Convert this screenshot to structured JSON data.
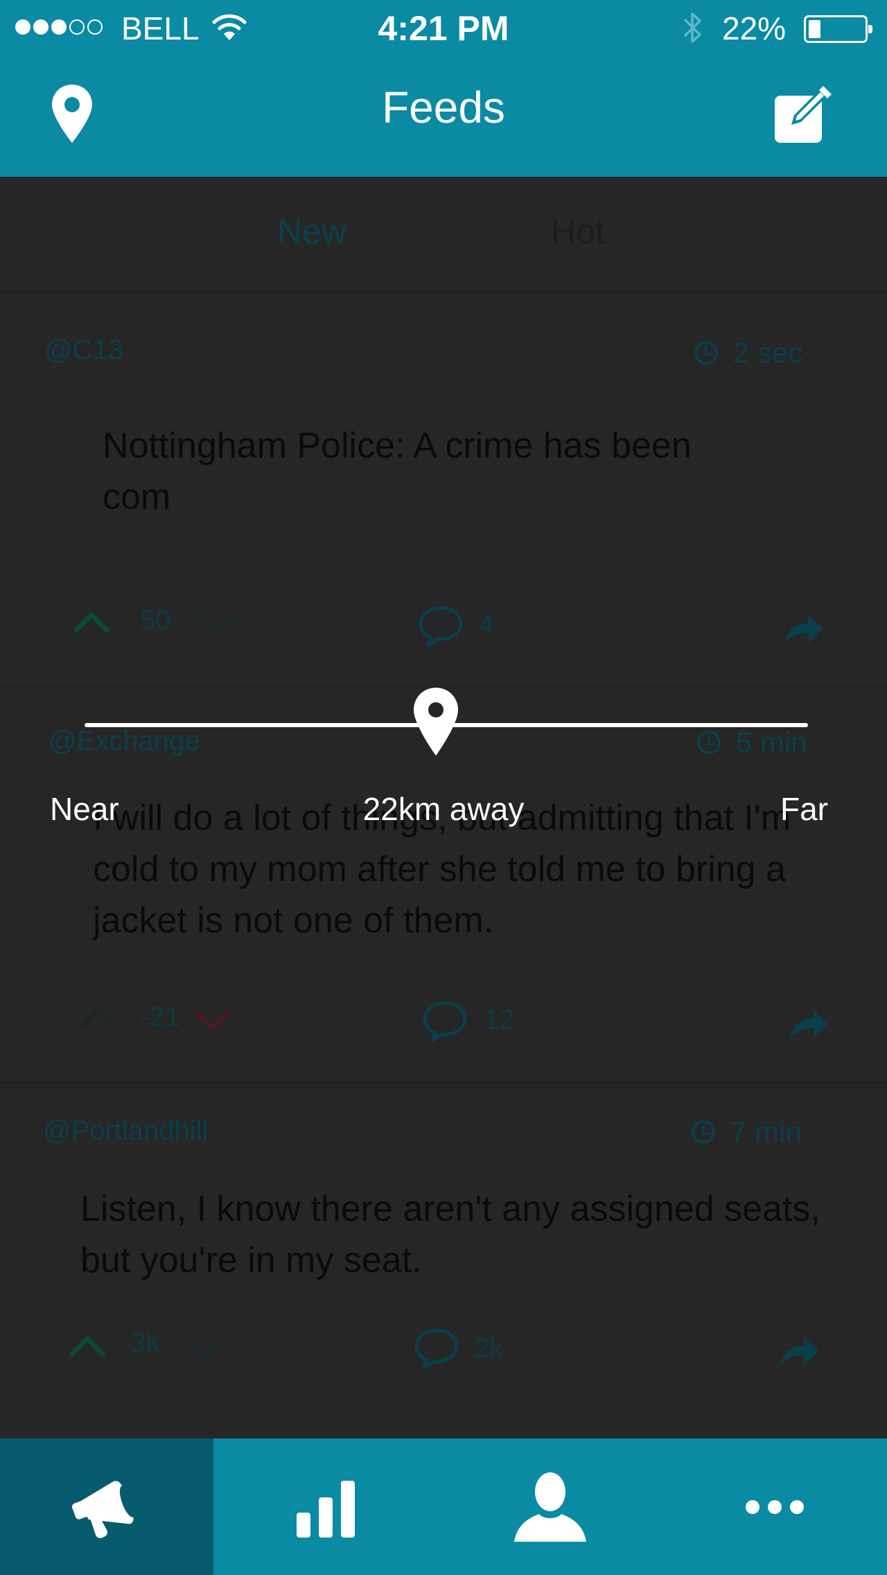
{
  "status_bar": {
    "carrier": "BELL",
    "time": "4:21 PM",
    "battery_percent": "22%",
    "battery_level": 0.22,
    "signal_bars_filled": 3,
    "signal_bars_total": 5
  },
  "nav": {
    "title": "Feeds",
    "left_icon": "location-pin-icon",
    "right_icon": "compose-icon"
  },
  "tabs": [
    {
      "label": "New",
      "active": true
    },
    {
      "label": "Hot",
      "active": false
    }
  ],
  "posts": [
    {
      "handle": "@C13",
      "time": "2 sec",
      "body": "Nottingham Police: A crime has been com",
      "score": "50",
      "comments": "4"
    },
    {
      "handle": "@Exchange",
      "time": "5 min",
      "body": "I will do a lot of things, but admitting that I'm cold to my mom after she told me to bring a jacket is not one of them.",
      "score": "-21",
      "comments": "12"
    },
    {
      "handle": "@Portlandhill",
      "time": "7 min",
      "body": "Listen, I know there aren't any assigned seats, but you're in my seat.",
      "score": "3k",
      "comments": "2k"
    }
  ],
  "distance_slider": {
    "min_label": "Near",
    "max_label": "Far",
    "value_label": "22km away",
    "value_fraction": 0.48
  },
  "tab_bar": [
    {
      "icon": "megaphone-icon",
      "active": true
    },
    {
      "icon": "bar-chart-icon",
      "active": false
    },
    {
      "icon": "user-icon",
      "active": false
    },
    {
      "icon": "more-icon",
      "active": false
    }
  ],
  "colors": {
    "brand_teal": "#0a8aa3",
    "active_tab_dark": "#085a6e",
    "overlay_background": "#262626",
    "downvote_active": "#4a1a20",
    "upvote": "#0a4a3a"
  }
}
